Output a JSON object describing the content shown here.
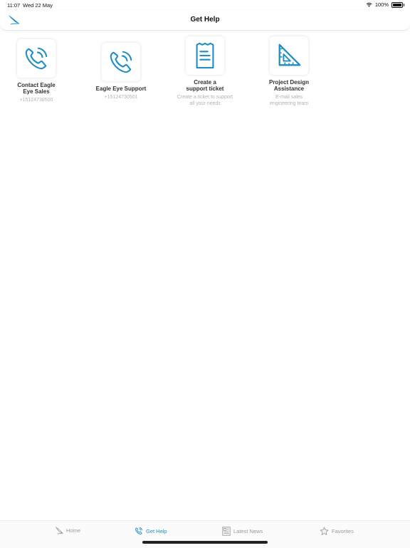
{
  "status": {
    "time": "11:07",
    "date": "Wed 22 May",
    "battery": "100%"
  },
  "header": {
    "title": "Get Help",
    "logo_icon": "eagle-feather-icon"
  },
  "cards": [
    {
      "title_line1": "Contact Eagle",
      "title_line2": "Eye Sales",
      "subtitle_line1": "+15124730500",
      "subtitle_line2": "",
      "icon": "phone-ringing-icon"
    },
    {
      "title_line1": "Eagle Eye Support",
      "title_line2": "",
      "subtitle_line1": "+15124730501",
      "subtitle_line2": "",
      "icon": "phone-ringing-icon"
    },
    {
      "title_line1": "Create a",
      "title_line2": "support ticket",
      "subtitle_line1": "Create a ticket to support",
      "subtitle_line2": "all your needs",
      "icon": "receipt-icon"
    },
    {
      "title_line1": "Project Design",
      "title_line2": "Assistance",
      "subtitle_line1": "E-mail sales",
      "subtitle_line2": "engineering team",
      "icon": "triangle-ruler-icon"
    }
  ],
  "tabs": [
    {
      "label": "Home",
      "icon": "feather-icon"
    },
    {
      "label": "Get Help",
      "icon": "phone-icon"
    },
    {
      "label": "Latest News",
      "icon": "newspaper-icon"
    },
    {
      "label": "Favorites",
      "icon": "star-icon"
    }
  ],
  "colors": {
    "accent": "#1d8fc4",
    "inactive": "#9a9a9a",
    "subtitle": "#b3b3b3"
  }
}
